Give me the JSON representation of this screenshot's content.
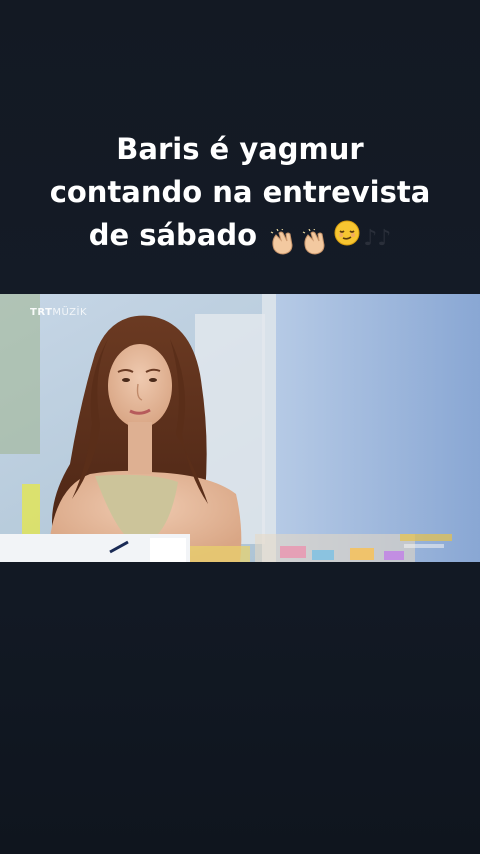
{
  "caption": {
    "line1": "Baris é yagmur",
    "line2": "contando na entrevista",
    "line3": "de sábado"
  },
  "emojis": [
    "clapping-hands",
    "clapping-hands",
    "relieved-face",
    "musical-notes"
  ],
  "notes_glyph": "♪♪",
  "video": {
    "watermark_bold": "TRT",
    "watermark_light": "MÜZİK"
  },
  "colors": {
    "background": "#131923",
    "caption_text": "#ffffff",
    "video_wall": "#9db6d8"
  }
}
